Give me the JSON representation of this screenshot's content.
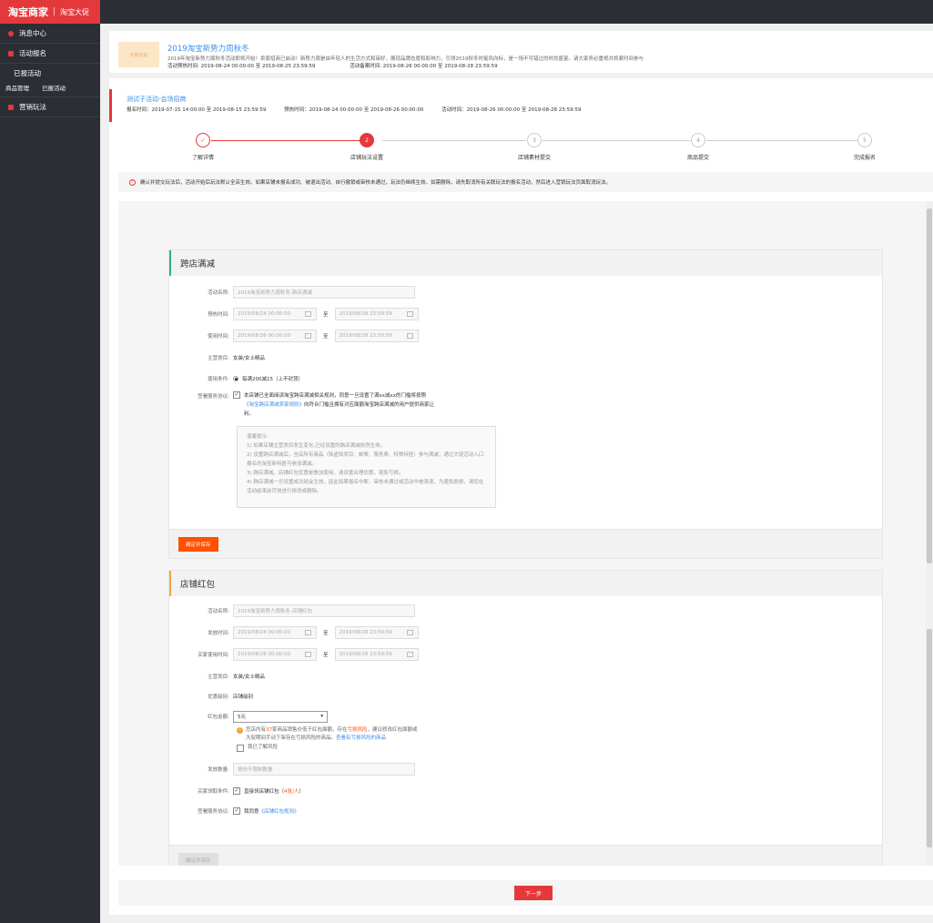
{
  "brand": {
    "name": "淘宝商家",
    "sub": "淘宝大促"
  },
  "sidebar": {
    "items": [
      {
        "label": "消息中心"
      },
      {
        "label": "活动报名"
      }
    ],
    "group": {
      "label": "已报活动",
      "subs": [
        "商品管理",
        "已报活动"
      ]
    },
    "marketing": {
      "label": "营销玩法"
    }
  },
  "banner": {
    "thumb": "天猫活动",
    "title": "2019淘宝新势力周秋冬",
    "desc": "2019年淘宝新势力周秋冬活动即将开始！卖家招商已启动！新势力周是由年轻人的生活方式和审好，展现品牌态度和影响力，引领2019秋冬时髦风向标，是一场不可错过的时尚盛宴。请大家务必重视并抓紧时间参与",
    "preheat": "活动预热时间: 2019-08-24 00:00:00 至 2019-08-25 23:59:59",
    "formal": "活动备案时间: 2019-08-26 00:00:00 至 2019-08-28 23:59:59"
  },
  "sub_activity": {
    "title": "测试子活动-会场招商",
    "signup": "报名时间：2019-07-15 14:00:00 至 2019-08-15 23:59:59",
    "preheat": "预热时间：2019-08-24 00:00:00 至 2019-08-26 00:00:00",
    "activity": "活动时间：2019-08-26 00:00:00 至 2019-08-28 23:59:59"
  },
  "steps": [
    {
      "num": "✓",
      "label": "了解详情",
      "state": "done"
    },
    {
      "num": "2",
      "label": "店铺玩法设置",
      "state": "active"
    },
    {
      "num": "3",
      "label": "店铺素材提交",
      "state": "todo"
    },
    {
      "num": "4",
      "label": "商品提交",
      "state": "todo"
    },
    {
      "num": "5",
      "label": "完成报名",
      "state": "todo"
    }
  ],
  "notice": "确认并提交玩法后，活动开始后玩法默认全店生效。如果店铺未报名成功、被退出活动、自行撤销或审核未通过，玩法仍继续生效。如需删除，请先取消所有关联玩法的报名活动，然后进入营销玩法页面取消玩法。",
  "cross": {
    "title": "跨店满减",
    "name_label": "活动名称:",
    "name_value": "2019淘宝新势力周秋冬-跨店满减",
    "preheat_label": "预热时间:",
    "preheat_start": "2019/08/24 00:00:00",
    "preheat_end": "2019/08/28 23:59:59",
    "use_label": "使用时间:",
    "use_start": "2019/08/26 00:00:00",
    "use_end": "2019/08/28 23:59:59",
    "to": "至",
    "category_label": "主营类目:",
    "category_value": "女装/女士精品",
    "cond_label": "使用条件:",
    "cond_value": "每满200减15（上不封顶）",
    "agree_label": "签署服务协议:",
    "agree_text_1": "本店铺已全面阅读淘宝跨店满减相关规则，同意一旦设置了满xx减xx的门槛将按照",
    "agree_link": "《淘宝跨店满减卖家规则》",
    "agree_text_2": "向符合门槛且拥有对应面额淘宝跨店满减的用户提供商家让利。",
    "tips": [
      "温馨提示:",
      "1) 如果店铺主营类目发生变化,已经设置的跨店满减依然生效。",
      "2) 设置跨店满减后，全店所有商品（除虚拟类目、邮费、服务费、特殊特医）参与满减；通过大促活动入口报名的淘宝新特医可参加满减。",
      "3) 跨店满减，店铺红包优惠是叠加使用，请设置合理优惠，避免亏损。",
      "4) 跨店满减一旦设置成功就会生效，因此如果报名中断，审核未通过或活动中被清退，为避免损损，请您在活动结束前尽快进行修改或删除。"
    ],
    "save": "确定并保存"
  },
  "redpack": {
    "title": "店铺红包",
    "name_label": "活动名称:",
    "name_value": "2019淘宝新势力周秋冬-店铺红包",
    "send_label": "发放时间:",
    "send_start": "2019/08/24 00:00:00",
    "send_end": "2019/08/28 23:59:59",
    "buyer_label": "买家使用时间:",
    "buyer_start": "2019/08/26 00:00:00",
    "buyer_end": "2019/08/28 23:59:59",
    "to": "至",
    "category_label": "主营类目:",
    "category_value": "女装/女士精品",
    "level_label": "优惠级别:",
    "level_value": "店铺级别",
    "amount_label": "红包金额:",
    "amount_value": "5元",
    "warn_1": "您店内有",
    "warn_num": "37",
    "warn_2": "家商品销售价低于红包面额，存在",
    "warn_risk": "亏损风险",
    "warn_3": "，建议修改红包面额或",
    "warn_line2": "大促期间手动下架存在亏损风险的商品。",
    "warn_link": "查看有亏损风险的商品",
    "know": "我已了解风险",
    "count_label": "发放数量:",
    "count_placeholder": "按份不限制数量",
    "cond_label": "买家领取条件:",
    "cond_value_1": "直接领店铺红包（",
    "cond_value_red": "4张/人",
    "cond_value_2": "）",
    "agree_label": "签署服务协议:",
    "agree_text": "我同意",
    "agree_link": "《店铺红包规则》",
    "save": "确定并保存"
  },
  "next": "下一步",
  "colors": {
    "accent": "#e4393c",
    "orange": "#ff5000",
    "link": "#3a8ee6",
    "sidebar": "#2b2e35"
  }
}
